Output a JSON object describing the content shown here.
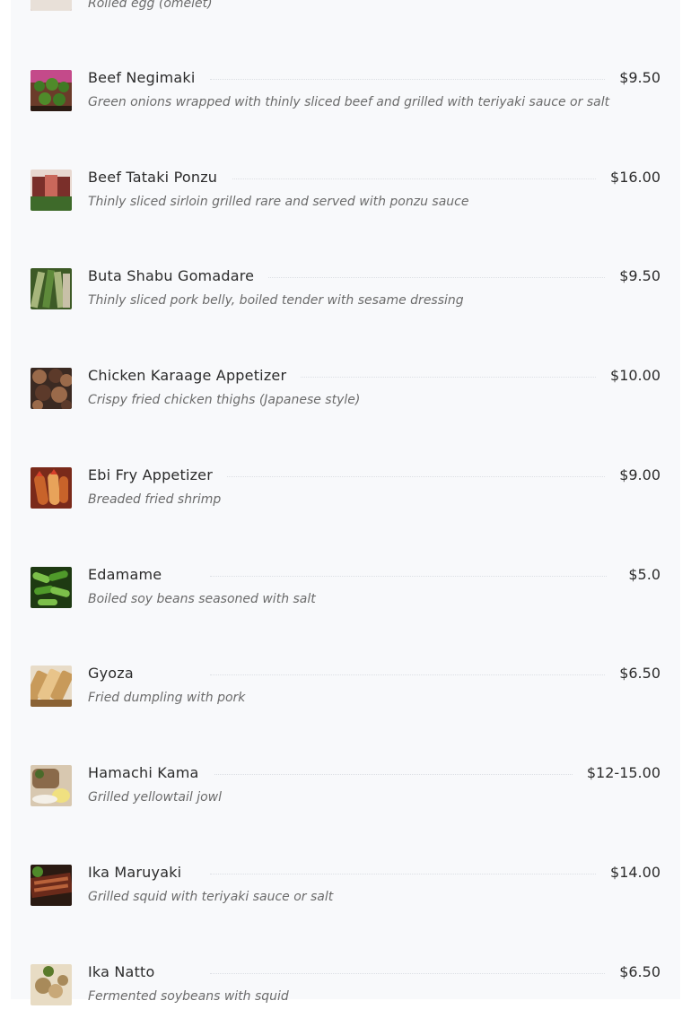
{
  "menu": {
    "partial_top_item": {
      "description": "Rolled egg (omelet)",
      "image_icon": "food-photo-rolled-egg"
    },
    "items": [
      {
        "name": "Beef Negimaki",
        "price": "$9.50",
        "description": "Green onions wrapped with thinly sliced beef and grilled with teriyaki sauce or salt",
        "image_icon": "food-photo-beef-negimaki",
        "colors": [
          "#6b3b2a",
          "#3f7a24",
          "#b84a3a"
        ]
      },
      {
        "name": "Beef Tataki Ponzu",
        "price": "$16.00",
        "description": "Thinly sliced sirloin grilled rare and served with ponzu sauce",
        "image_icon": "food-photo-beef-tataki",
        "colors": [
          "#7a2f2a",
          "#c9685b",
          "#3e6a2a"
        ]
      },
      {
        "name": "Buta Shabu Gomadare",
        "price": "$9.50",
        "description": "Thinly sliced pork belly, boiled tender with sesame dressing",
        "image_icon": "food-photo-buta-shabu",
        "colors": [
          "#5e8a3a",
          "#a7b67c",
          "#3d5a26"
        ]
      },
      {
        "name": "Chicken Karaage Appetizer",
        "price": "$10.00",
        "description": "Crispy fried chicken thighs (Japanese style)",
        "image_icon": "food-photo-chicken-karaage",
        "colors": [
          "#5c3a2a",
          "#9a6a4a",
          "#3b2a22"
        ]
      },
      {
        "name": "Ebi Fry Appetizer",
        "price": "$9.00",
        "description": "Breaded fried shrimp",
        "image_icon": "food-photo-ebi-fry",
        "colors": [
          "#c8632a",
          "#e8a35a",
          "#7a2a1a"
        ]
      },
      {
        "name": "Edamame",
        "price": "$5.0",
        "description": "Boiled soy beans seasoned with salt",
        "image_icon": "food-photo-edamame",
        "colors": [
          "#4f9a2a",
          "#7cc04a",
          "#1e3a12"
        ]
      },
      {
        "name": "Gyoza",
        "price": "$6.50",
        "description": "Fried dumpling with pork",
        "image_icon": "food-photo-gyoza",
        "colors": [
          "#c89a5a",
          "#e8c48a",
          "#8a6234"
        ]
      },
      {
        "name": "Hamachi Kama",
        "price": "$12-15.00",
        "description": "Grilled yellowtail jowl",
        "image_icon": "food-photo-hamachi-kama",
        "colors": [
          "#8a6a4a",
          "#d8c8b0",
          "#4a6a2a"
        ]
      },
      {
        "name": "Ika Maruyaki",
        "price": "$14.00",
        "description": "Grilled squid with teriyaki sauce or salt",
        "image_icon": "food-photo-ika-maruyaki",
        "colors": [
          "#6a2a1a",
          "#b8623a",
          "#2a1a12"
        ]
      },
      {
        "name": "Ika Natto",
        "price": "$6.50",
        "description": "Fermented soybeans with squid",
        "image_icon": "food-photo-ika-natto",
        "colors": [
          "#a88a5a",
          "#e8dcc4",
          "#5a7a2a"
        ]
      }
    ]
  }
}
